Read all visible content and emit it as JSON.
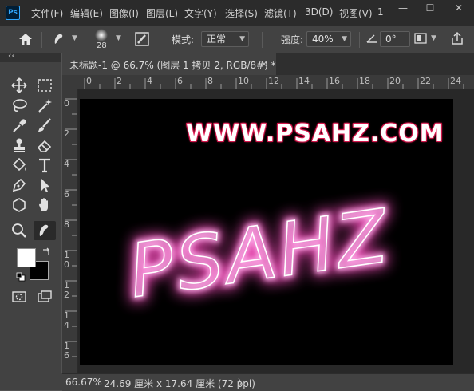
{
  "app": {
    "logo": "Ps"
  },
  "menu": [
    "文件(F)",
    "编辑(E)",
    "图像(I)",
    "图层(L)",
    "文字(Y)",
    "选择(S)",
    "滤镜(T)",
    "3D(D)",
    "视图(V)",
    "1"
  ],
  "window_controls": {
    "minimize": "—",
    "maximize": "☐",
    "close": "✕"
  },
  "options": {
    "brush_size": "28",
    "mode_label": "模式:",
    "mode_value": "正常",
    "strength_label": "强度:",
    "strength_value": "40%",
    "angle_value": "0°"
  },
  "toolpanel": {
    "collapse": "‹‹"
  },
  "document": {
    "tab_title": "未标题-1 @ 66.7% (图层 1 拷贝 2, RGB/8#) *",
    "tab_close": "×",
    "watermark": "WWW.PSAHZ.COM",
    "artwork_text": "PSAHZ"
  },
  "rulers": {
    "top": [
      "0",
      "2",
      "4",
      "6",
      "8",
      "10",
      "12",
      "14",
      "16",
      "18",
      "20",
      "22",
      "24"
    ],
    "left": [
      "0",
      "2",
      "4",
      "6",
      "8",
      "1\n0",
      "1\n2",
      "1\n4",
      "1\n6"
    ]
  },
  "status": {
    "zoom": "66.67%",
    "doc_size": "24.69 厘米 x 17.64 厘米 (72 ppi)",
    "arrow": "〉"
  },
  "colors": {
    "foreground": "#ffffff",
    "background": "#000000",
    "accent": "#31a8ff",
    "glow": "#ff9be0"
  }
}
